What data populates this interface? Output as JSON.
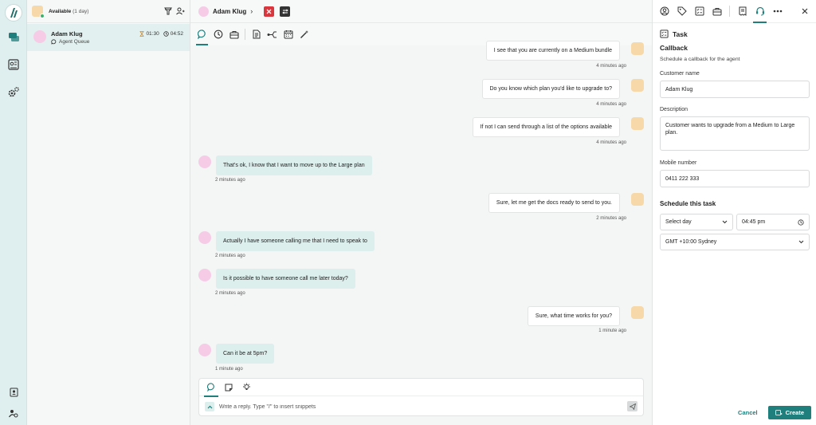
{
  "agent": {
    "status": "Available",
    "status_detail": "(1 day)"
  },
  "conversation": {
    "name": "Adam Klug",
    "queue": "Agent Queue",
    "wait_time": "01:30",
    "handle_time": "04:52"
  },
  "header": {
    "contact_name": "Adam Klug"
  },
  "messages": [
    {
      "direction": "out",
      "text": "I see that you are currently on a Medium bundle",
      "time": "4 minutes ago"
    },
    {
      "direction": "out",
      "text": "Do you know which plan you'd like to upgrade to?",
      "time": "4 minutes ago"
    },
    {
      "direction": "out",
      "text": "If not I can send through a list of the options available",
      "time": "4 minutes ago"
    },
    {
      "direction": "in",
      "text": "That's ok, I know that I want to move up to the Large plan",
      "time": "2 minutes ago"
    },
    {
      "direction": "out",
      "text": "Sure, let me get the docs ready to send to you.",
      "time": "2 minutes ago"
    },
    {
      "direction": "in",
      "text": "Actually I have someone calling me that I need to speak to",
      "time": "2 minutes ago"
    },
    {
      "direction": "in",
      "text": "Is it possible to have someone call me later today?",
      "time": "2 minutes ago"
    },
    {
      "direction": "out",
      "text": "Sure, what time works for you?",
      "time": "1 minute ago"
    },
    {
      "direction": "in",
      "text": "Can it be at 5pm?",
      "time": "1 minute ago"
    }
  ],
  "composer": {
    "placeholder": "Write a reply. Type \"/\" to insert snippets"
  },
  "task": {
    "panel_title": "Task",
    "section_title": "Callback",
    "section_desc": "Schedule a callback for the agent",
    "customer_label": "Customer name",
    "customer_value": "Adam Klug",
    "description_label": "Description",
    "description_value": "Customer wants to upgrade from a Medium to Large plan.",
    "mobile_label": "Mobile number",
    "mobile_value": "0411 222 333",
    "schedule_title": "Schedule this task",
    "day_value": "Select day",
    "time_value": "04:45  pm",
    "timezone_value": "GMT +10:00 Sydney",
    "cancel_label": "Cancel",
    "create_label": "Create"
  },
  "colors": {
    "accent": "#1f7f7d",
    "end_chat": "#d9363e",
    "incoming_bubble": "#dcefed"
  }
}
